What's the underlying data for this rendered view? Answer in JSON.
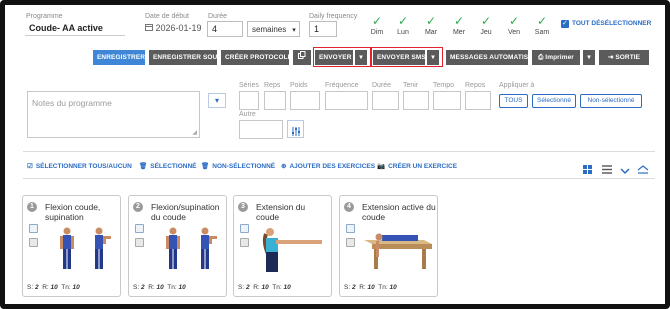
{
  "header": {
    "program_label": "Programme",
    "program_name": "Coude- AA active",
    "start_date_label": "Date de début",
    "start_date": "2026-01-19",
    "duration_label": "Durée",
    "duration_value": "4",
    "duration_unit": "semaines",
    "daily_frequency_label": "Daily frequency",
    "daily_frequency_value": "1",
    "days": [
      "Dim",
      "Lun",
      "Mar",
      "Mer",
      "Jeu",
      "Ven",
      "Sam"
    ],
    "deselect_all_label": "TOUT DÉSÉLECTIONNER"
  },
  "toolbar": {
    "save": "ENREGISTRER",
    "save_as": "ENREGISTRER SOUS",
    "create_protocol": "CRÉER PROTOCOLE",
    "send": "ENVOYER",
    "send_sms": "ENVOYER SMS",
    "auto_messages": "MESSAGES AUTOMATISÉS",
    "print": "Imprimer",
    "exit": "SORTIE"
  },
  "notes": {
    "placeholder": "Notes du programme"
  },
  "params": {
    "labels": [
      "Séries",
      "Reps",
      "Poids",
      "Fréquence",
      "Durée",
      "Tenir",
      "Tempo",
      "Repos"
    ],
    "apply_label": "Appliquer à",
    "apply_options": [
      "TOUS",
      "Sélectionné",
      "Non-sélectionné"
    ],
    "other_label": "Autre"
  },
  "actions": {
    "select_all": "SÉLECTIONNER TOUS/AUCUN",
    "selected": "SÉLECTIONNÉ",
    "not_selected": "NON-SÉLECTIONNÉ",
    "add_exercises": "AJOUTER DES EXERCICES",
    "create_exercise": "CRÉER UN EXERCICE"
  },
  "exercises": [
    {
      "number": "1",
      "title": "Flexion coude, supination",
      "sets_label": "S:",
      "sets": "2",
      "reps_label": "R:",
      "reps": "10",
      "hold_label": "Tn:",
      "hold": "10"
    },
    {
      "number": "2",
      "title": "Flexion/supination du coude",
      "sets_label": "S:",
      "sets": "2",
      "reps_label": "R:",
      "reps": "10",
      "hold_label": "Tn:",
      "hold": "10"
    },
    {
      "number": "3",
      "title": "Extension du coude",
      "sets_label": "S:",
      "sets": "2",
      "reps_label": "R:",
      "reps": "10",
      "hold_label": "Tn:",
      "hold": "10"
    },
    {
      "number": "4",
      "title": "Extension active du coude",
      "sets_label": "S:",
      "sets": "2",
      "reps_label": "R:",
      "reps": "10",
      "hold_label": "Tn:",
      "hold": "10"
    }
  ],
  "colors": {
    "accent": "#2b6cc4",
    "check": "#2fa84f",
    "highlight": "#e0232d",
    "button": "#5b5b5b",
    "primary_button": "#3f86d6"
  }
}
